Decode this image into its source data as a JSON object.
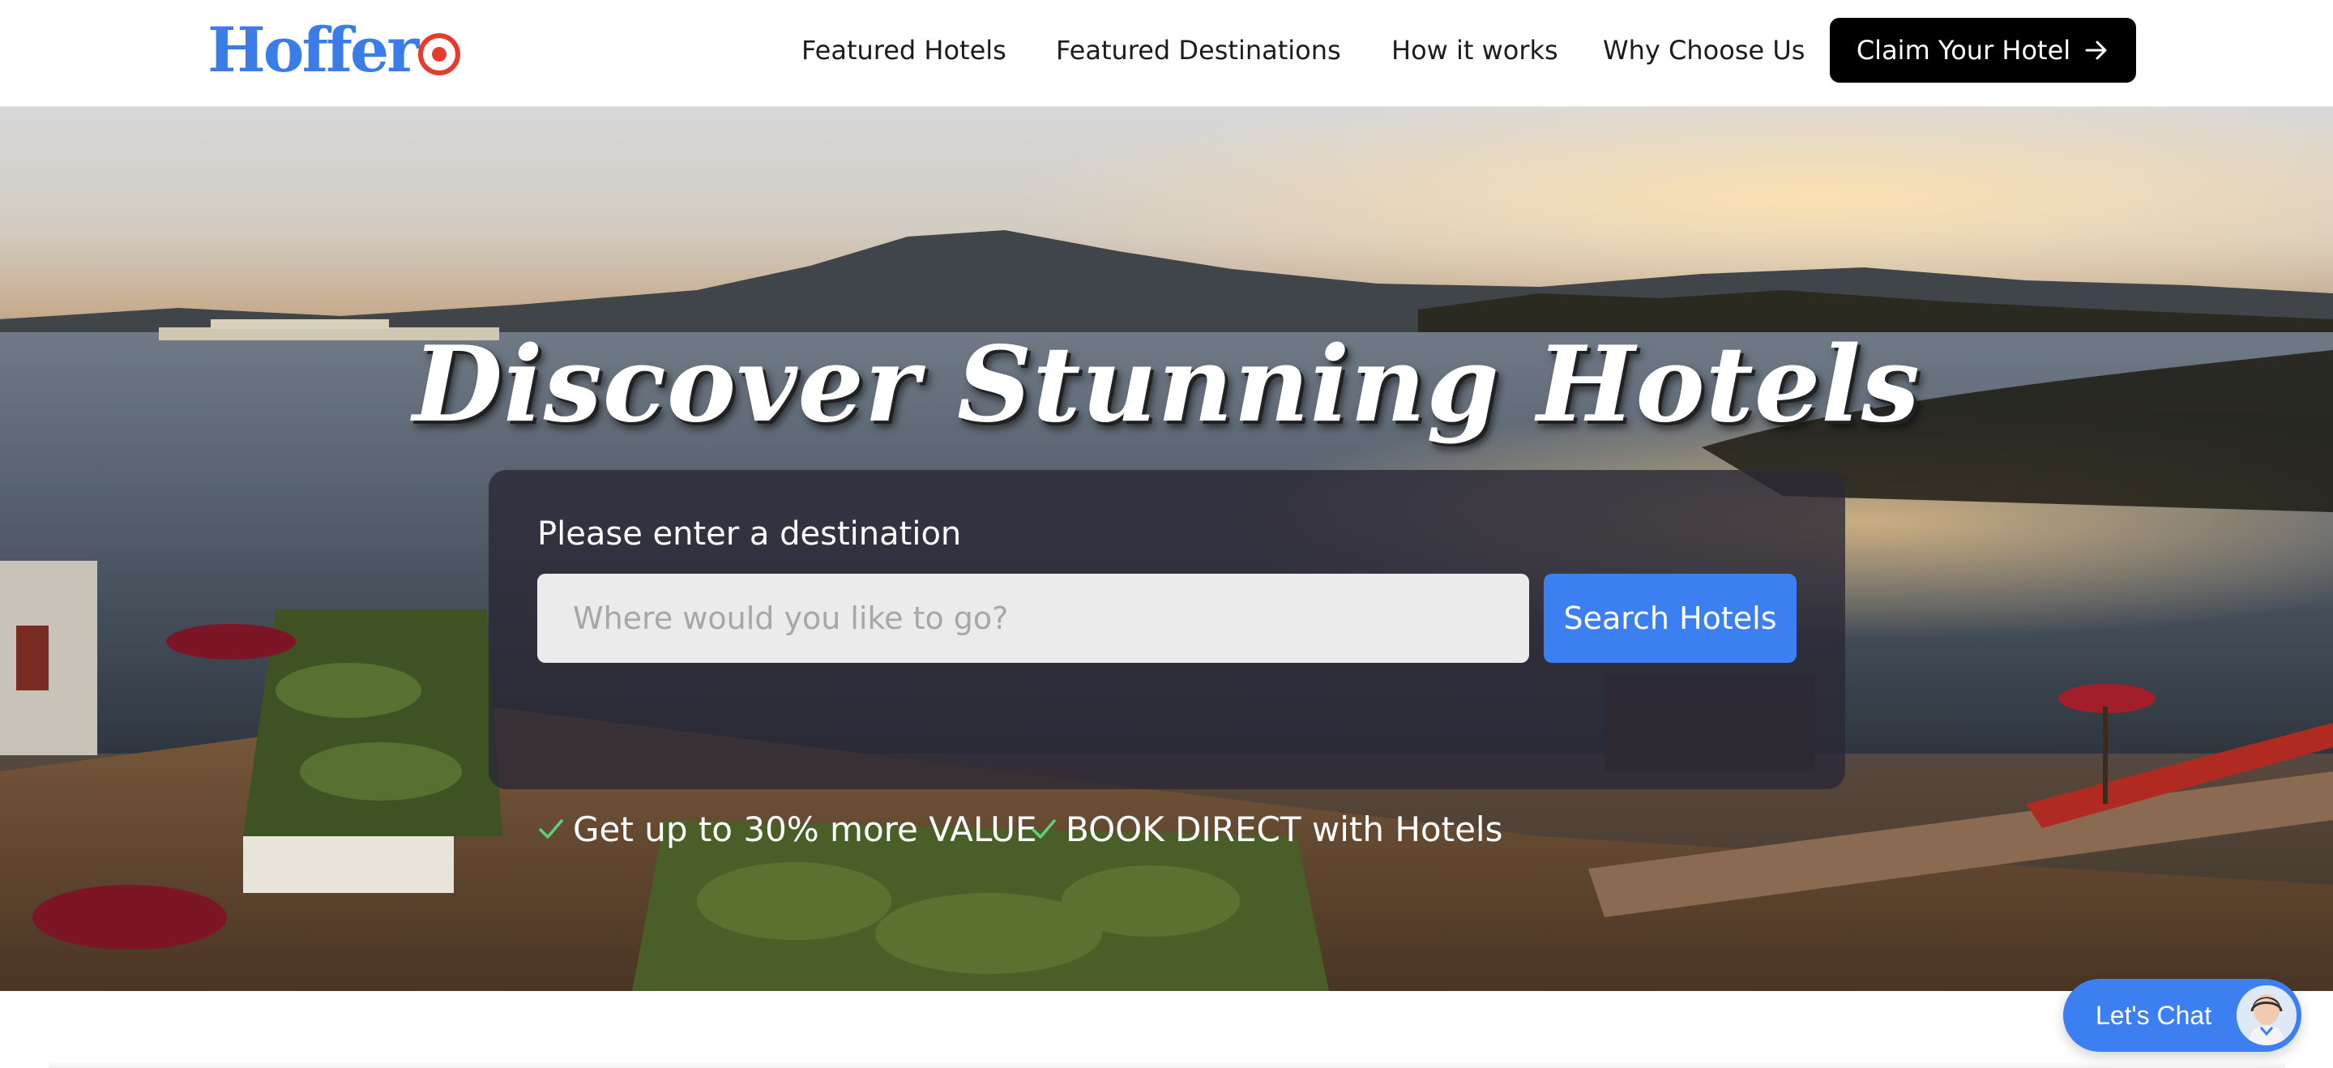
{
  "brand": {
    "logo_text": "Hoffer",
    "logo_color": "#3b7de8",
    "logo_accent_color": "#e63b2e"
  },
  "nav": {
    "items": [
      {
        "label": "Featured Hotels"
      },
      {
        "label": "Featured Destinations"
      },
      {
        "label": "How it works"
      },
      {
        "label": "Why Choose Us"
      }
    ],
    "cta_label": "Claim Your Hotel",
    "cta_icon": "arrow-right-icon"
  },
  "hero": {
    "title": "Discover Stunning Hotels",
    "search": {
      "label": "Please enter a destination",
      "placeholder": "Where would you like to go?",
      "value": "",
      "button_label": "Search Hotels"
    },
    "perks": [
      {
        "icon": "checkmark-icon",
        "text": "Get up to 30% more VALUE"
      },
      {
        "icon": "checkmark-icon",
        "text": "BOOK DIRECT with Hotels"
      }
    ]
  },
  "chat": {
    "label": "Let's Chat",
    "icon": "support-agent-avatar"
  },
  "colors": {
    "primary": "#3b7ff1",
    "cta_background": "#000000",
    "panel_background": "rgba(42,40,54,0.80)",
    "checkmark": "#5fd17a"
  }
}
